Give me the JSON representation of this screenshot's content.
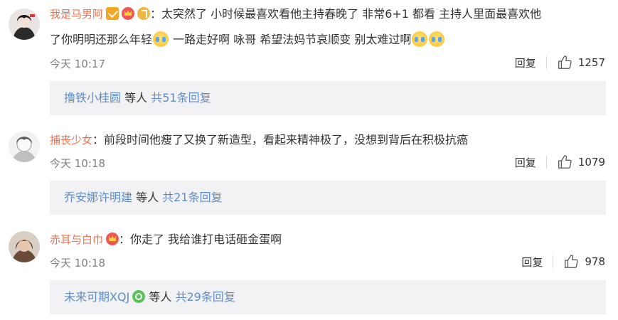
{
  "comments": [
    {
      "user": "我是马男阿",
      "badges": [
        "verified-v-icon",
        "crown-badge-icon",
        "music-badge-icon"
      ],
      "text_line1": "：太突然了 小时候最喜欢看他主持春晚了 非常6+1 都看 主持人里面最喜欢他",
      "text_line2a": "了你明明还那么年轻",
      "text_line2b": " 一路走好啊  咏哥  希望法妈节哀顺变  别太难过啊",
      "time": "今天 10:17",
      "reply_label": "回复",
      "likes": "1257",
      "replies": {
        "first_user": "撸铁小桂圆",
        "and_others": " 等人 ",
        "total": "共51条回复"
      }
    },
    {
      "user": "捕丧少女",
      "badges": [],
      "text_line1": "：前段时间他瘦了又换了新造型，看起来精神极了，没想到背后在积极抗癌",
      "time": "今天 10:18",
      "reply_label": "回复",
      "likes": "1079",
      "replies": {
        "first_user": "乔安娜许明建",
        "and_others": " 等人 ",
        "total": "共21条回复"
      }
    },
    {
      "user": "赤耳与白巾",
      "badges": [
        "crown-badge-icon"
      ],
      "text_line1": "：你走了 我给谁打电话砸金蛋啊",
      "time": "今天 10:18",
      "reply_label": "回复",
      "likes": "978",
      "replies": {
        "first_user": "未来可期XQJ",
        "and_others": " 等人 ",
        "total": "共29条回复"
      }
    }
  ],
  "colors": {
    "username": "#eb7350",
    "link": "#5d8dc8",
    "meta": "#808080",
    "reply_bg": "#f2f2f5"
  }
}
